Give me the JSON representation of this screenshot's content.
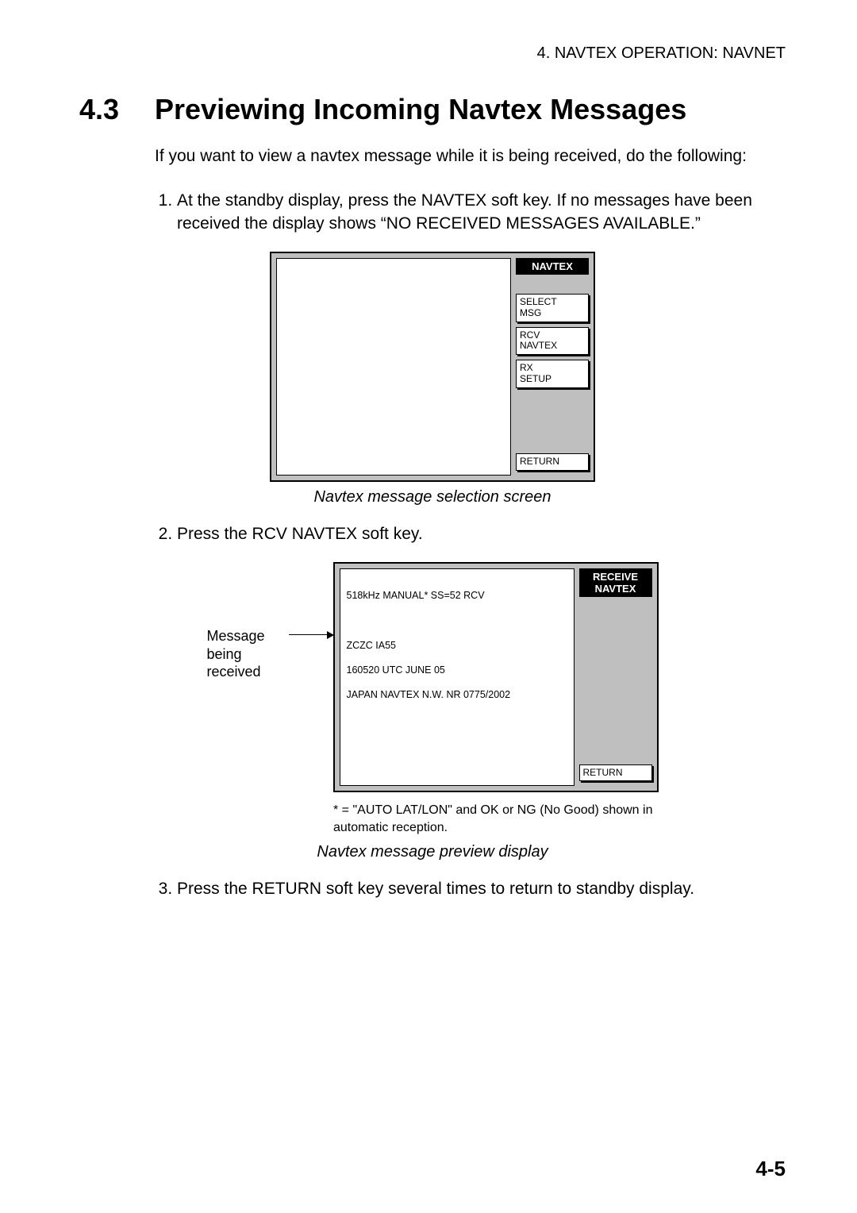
{
  "chapter_header": "4. NAVTEX OPERATION: NAVNET",
  "section_number": "4.3",
  "section_title": "Previewing Incoming Navtex Messages",
  "intro": "If you want to view a navtex message while it is being received, do the following:",
  "steps": {
    "s1": "At the standby display, press the NAVTEX soft key. If no messages have been received the display shows “NO RECEIVED MESSAGES AVAILABLE.”",
    "s2": "Press the RCV NAVTEX soft key.",
    "s3": "Press the RETURN soft key several times to return to standby display."
  },
  "fig1": {
    "title": "NAVTEX",
    "keys": {
      "select_msg": "SELECT\nMSG",
      "rcv_navtex": "RCV\nNAVTEX",
      "rx_setup": "RX\nSETUP",
      "return": "RETURN"
    },
    "caption": "Navtex message selection screen"
  },
  "fig2": {
    "title": "RECEIVE\nNAVTEX",
    "status_line": "518kHz MANUAL* SS=52 RCV",
    "msg_line1": "ZCZC  IA55",
    "msg_line2": "160520 UTC JUNE 05",
    "msg_line3": "JAPAN NAVTEX N.W. NR 0775/2002",
    "return": "RETURN",
    "callout": "Message\nbeing\nreceived",
    "footnote": "* = \"AUTO LAT/LON\" and OK or NG (No Good) shown in automatic reception.",
    "caption": "Navtex message preview display"
  },
  "page_number": "4-5"
}
